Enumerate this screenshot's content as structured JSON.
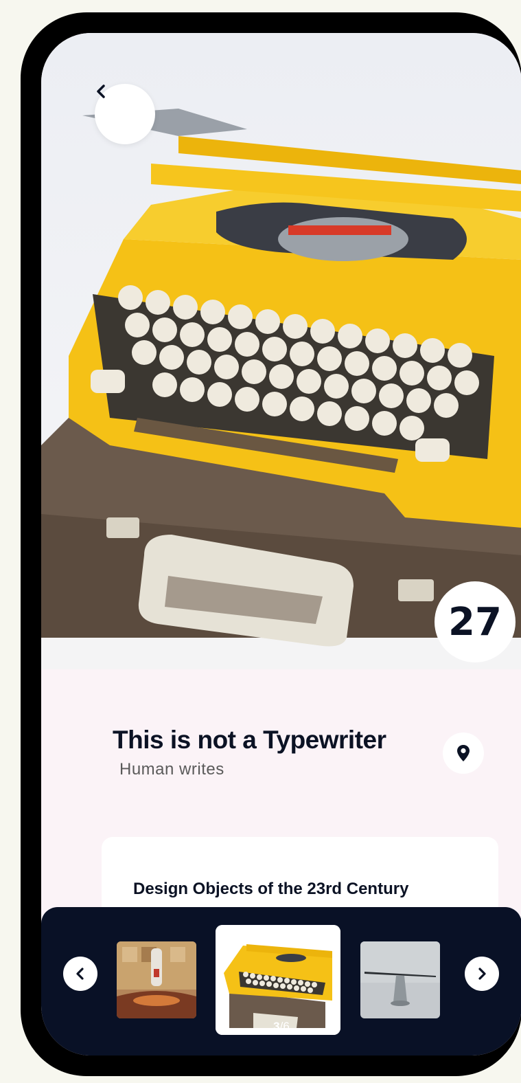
{
  "product": {
    "title": "This is not a Typewriter",
    "subtitle": "Human writes",
    "count": "27"
  },
  "collection": {
    "title": "Design Objects of the 23rd Century"
  },
  "carousel": {
    "current": "3",
    "total": "6",
    "separator": "/"
  },
  "icons": {
    "back": "chevron-left-icon",
    "location": "map-pin-icon",
    "prev": "chevron-left-icon",
    "next": "chevron-right-icon"
  },
  "colors": {
    "dark": "#091126",
    "accent_yellow": "#f5c116",
    "background": "#fbf3f7"
  }
}
